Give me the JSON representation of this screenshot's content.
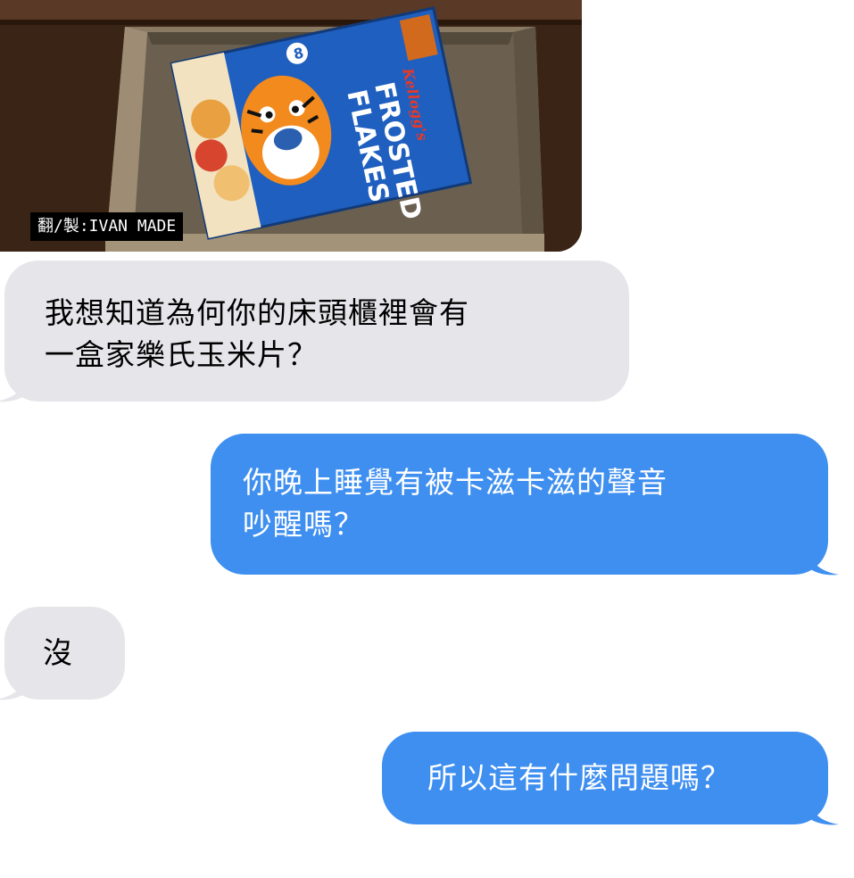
{
  "photo": {
    "description_icon": "frosted-flakes-box-in-drawer-photo",
    "watermark": "翻/製:IVAN MADE",
    "box_brand": "Kellogg's",
    "box_title_line1": "FROSTED",
    "box_title_line2": "FLAKES"
  },
  "messages": [
    {
      "side": "received",
      "lines": [
        "我想知道為何你的床頭櫃裡會有",
        "一盒家樂氏玉米片？"
      ]
    },
    {
      "side": "sent",
      "lines": [
        "你晚上睡覺有被卡滋卡滋的聲音",
        "吵醒嗎？"
      ]
    },
    {
      "side": "received",
      "lines": [
        "沒"
      ]
    },
    {
      "side": "sent",
      "lines": [
        "所以這有什麼問題嗎？"
      ]
    }
  ],
  "colors": {
    "sent_bubble": "#3f8ff0",
    "received_bubble": "#e6e6ea",
    "background": "#ffffff"
  }
}
